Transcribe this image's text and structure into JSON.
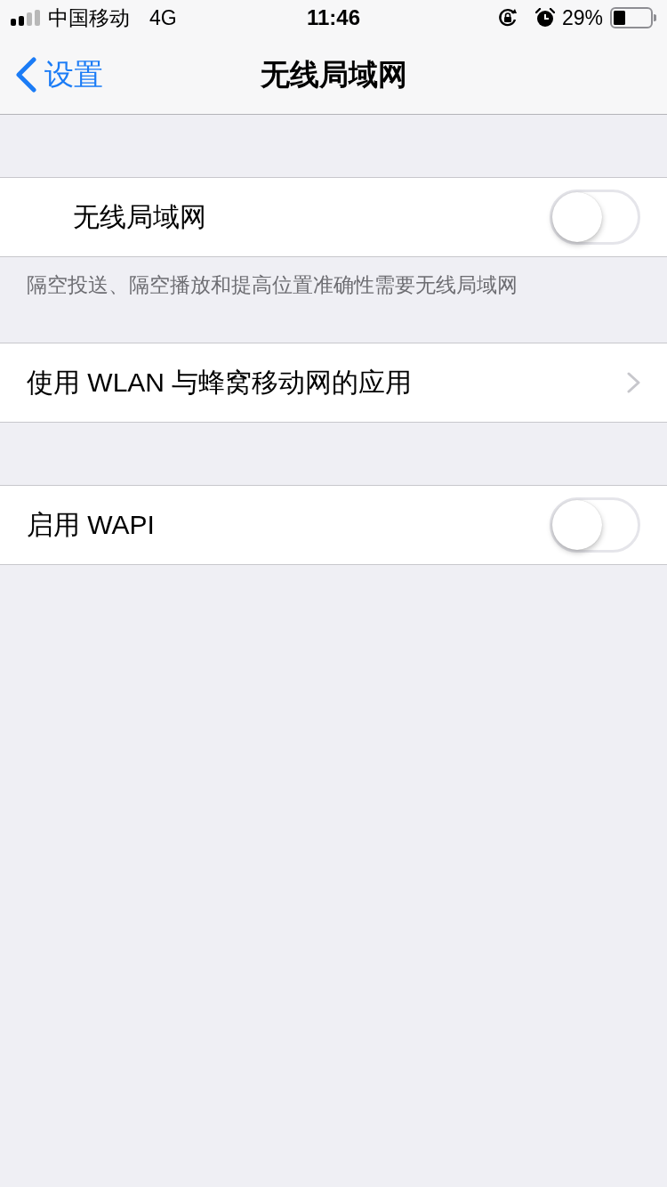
{
  "status_bar": {
    "carrier": "中国移动",
    "network": "4G",
    "time": "11:46",
    "battery": "29%"
  },
  "nav_bar": {
    "back": "设置",
    "title": "无线局域网"
  },
  "sections": [
    {
      "rows": [
        {
          "kind": "master_toggle",
          "label": "无线局域网",
          "on": false
        }
      ],
      "footer": "隔空投送、隔空播放和提高位置准确性需要无线局域网"
    },
    {
      "rows": [
        {
          "kind": "link",
          "label": "使用 WLAN 与蜂窝移动网的应用"
        }
      ]
    },
    {
      "rows": [
        {
          "kind": "toggle",
          "label": "启用 WAPI",
          "on": false
        }
      ]
    }
  ]
}
